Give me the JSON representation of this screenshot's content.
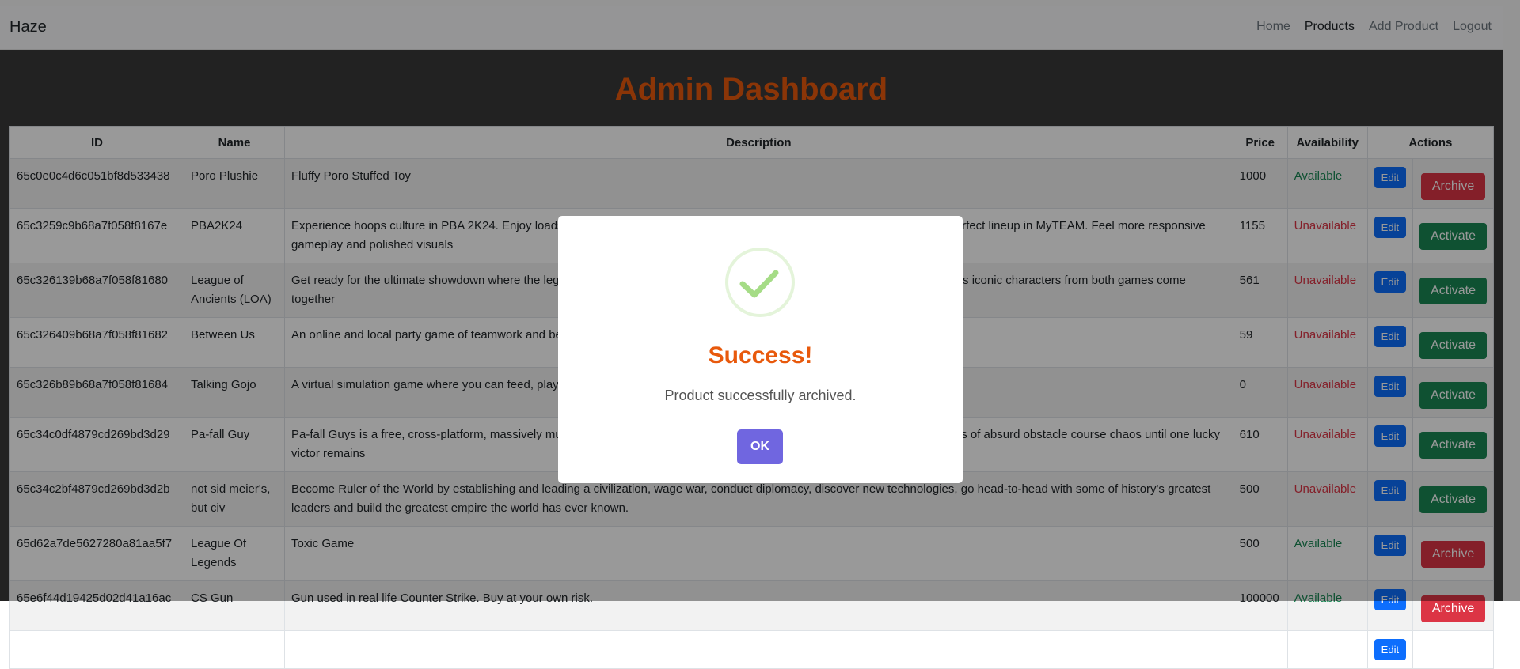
{
  "navbar": {
    "brand": "Haze",
    "links": [
      {
        "label": "Home",
        "active": false
      },
      {
        "label": "Products",
        "active": true
      },
      {
        "label": "Add Product",
        "active": false
      },
      {
        "label": "Logout",
        "active": false
      }
    ]
  },
  "page_title": "Admin Dashboard",
  "table": {
    "headers": [
      "ID",
      "Name",
      "Description",
      "Price",
      "Availability",
      "Actions"
    ],
    "rows": [
      {
        "id": "65c0e0c4d6c051bf8d533438",
        "name": "Poro Plushie",
        "description": "Fluffy Poro Stuffed Toy",
        "price": "1000",
        "availability": "Available",
        "edit": "Edit",
        "action": "Archive"
      },
      {
        "id": "65c3259c9b68a7f058f8167e",
        "name": "PBA2K24",
        "description": "Experience hoops culture in PBA 2K24. Enjoy loads of authentic hoops as well as Ya-PLAYER and assist ASSIST. Build your perfect lineup in MyTEAM. Feel more responsive gameplay and polished visuals",
        "price": "1155",
        "availability": "Unavailable",
        "edit": "Edit",
        "action": "Activate"
      },
      {
        "id": "65c326139b68a7f058f81680",
        "name": "League of Ancients (LOA)",
        "description": "Get ready for the ultimate showdown where the legends of League and Dota collide! Step into the arena and choose your side as iconic characters from both games come together",
        "price": "561",
        "availability": "Unavailable",
        "edit": "Edit",
        "action": "Activate"
      },
      {
        "id": "65c326409b68a7f058f81682",
        "name": "Between Us",
        "description": "An online and local party game of teamwork and betrayal",
        "price": "59",
        "availability": "Unavailable",
        "edit": "Edit",
        "action": "Activate"
      },
      {
        "id": "65c326b89b68a7f058f81684",
        "name": "Talking Gojo",
        "description": "A virtual simulation game where you can feed, play and talk with Gojo with in-app purchases",
        "price": "0",
        "availability": "Unavailable",
        "edit": "Edit",
        "action": "Activate"
      },
      {
        "id": "65c34c0df4879cd269bd3d29",
        "name": "Pa-fall Guy",
        "description": "Pa-fall Guys is a free, cross-platform, massively multiplayer party royale game where players compete through escalating rounds of absurd obstacle course chaos until one lucky victor remains",
        "price": "610",
        "availability": "Unavailable",
        "edit": "Edit",
        "action": "Activate"
      },
      {
        "id": "65c34c2bf4879cd269bd3d2b",
        "name": "not sid meier's, but civ",
        "description": "Become Ruler of the World by establishing and leading a civilization, wage war, conduct diplomacy, discover new technologies, go head-to-head with some of history's greatest leaders and build the greatest empire the world has ever known.",
        "price": "500",
        "availability": "Unavailable",
        "edit": "Edit",
        "action": "Activate"
      },
      {
        "id": "65d62a7de5627280a81aa5f7",
        "name": "League Of Legends",
        "description": "Toxic Game",
        "price": "500",
        "availability": "Available",
        "edit": "Edit",
        "action": "Archive"
      },
      {
        "id": "65e6f44d19425d02d41a16ac",
        "name": "CS Gun",
        "description": "Gun used in real life Counter Strike. Buy at your own risk.",
        "price": "100000",
        "availability": "Available",
        "edit": "Edit",
        "action": "Archive"
      },
      {
        "id": "",
        "name": "",
        "description": "",
        "price": "",
        "availability": "",
        "edit": "Edit",
        "action": ""
      }
    ]
  },
  "modal": {
    "title": "Success!",
    "text": "Product successfully archived.",
    "ok_label": "OK",
    "icon": "checkmark-icon"
  },
  "colors": {
    "accent_orange": "#e8590c",
    "available": "#198754",
    "unavailable": "#dc3545",
    "edit_button": "#0d6efd",
    "ok_button": "#7066e0"
  }
}
